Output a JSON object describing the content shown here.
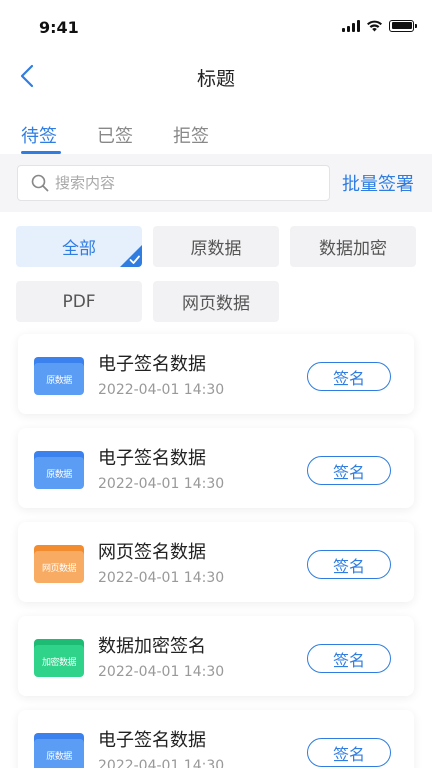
{
  "status_bar": {
    "time": "9:41"
  },
  "nav": {
    "title": "标题"
  },
  "tabs": [
    {
      "label": "待签",
      "active": true
    },
    {
      "label": "已签",
      "active": false
    },
    {
      "label": "拒签",
      "active": false
    }
  ],
  "search": {
    "placeholder": "搜索内容",
    "batch_label": "批量签署"
  },
  "filters": [
    {
      "label": "全部",
      "active": true
    },
    {
      "label": "原数据",
      "active": false
    },
    {
      "label": "数据加密",
      "active": false
    },
    {
      "label": "PDF",
      "active": false
    },
    {
      "label": "网页数据",
      "active": false
    }
  ],
  "items": [
    {
      "title": "电子签名数据",
      "time": "2022-04-01  14:30",
      "icon_label": "原数据",
      "icon": "folder-blue-icon",
      "button": "签名"
    },
    {
      "title": "电子签名数据",
      "time": "2022-04-01  14:30",
      "icon_label": "原数据",
      "icon": "folder-blue-icon",
      "button": "签名"
    },
    {
      "title": "网页签名数据",
      "time": "2022-04-01  14:30",
      "icon_label": "网页数据",
      "icon": "folder-orange-icon",
      "button": "签名"
    },
    {
      "title": "数据加密签名",
      "time": "2022-04-01  14:30",
      "icon_label": "加密数据",
      "icon": "folder-green-icon",
      "button": "签名"
    },
    {
      "title": "电子签名数据",
      "time": "2022-04-01  14:30",
      "icon_label": "原数据",
      "icon": "folder-blue-icon",
      "button": "签名"
    }
  ],
  "colors": {
    "accent": "#2f7de1",
    "folder_blue_back": "#3b82ee",
    "folder_blue_front": "#5b9cf5",
    "folder_orange_back": "#f28c2e",
    "folder_orange_front": "#f8ab62",
    "folder_green_back": "#1dbb73",
    "folder_green_front": "#2fd48a"
  }
}
